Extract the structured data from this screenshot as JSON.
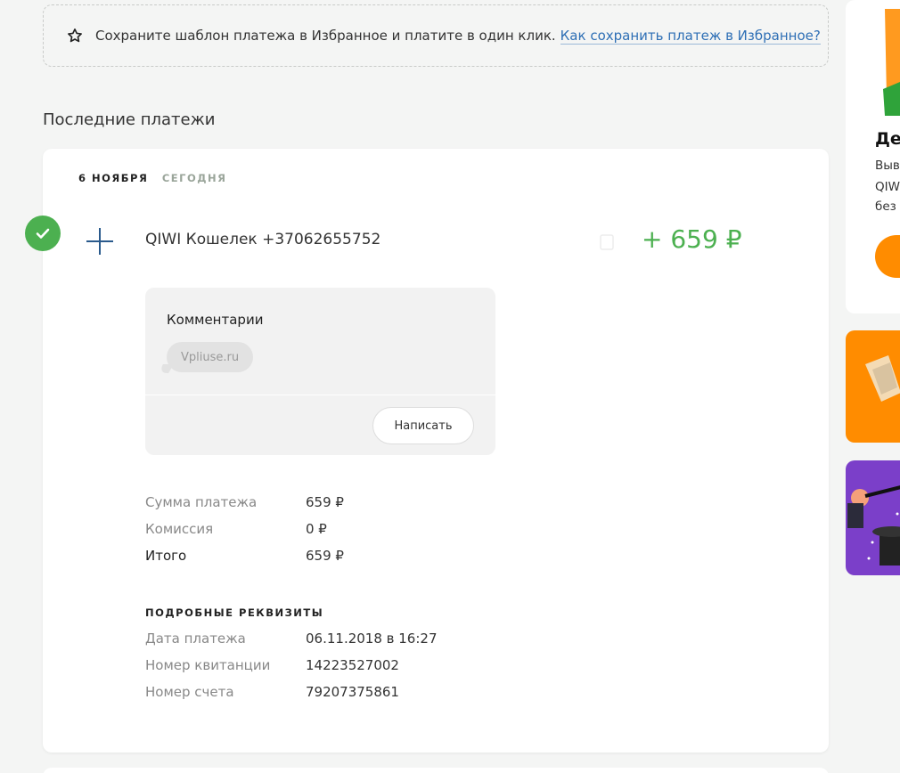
{
  "banner": {
    "text": "Сохраните шаблон платежа в Избранное и платите в один клик.",
    "link": "Как сохранить платеж в Избранное?",
    "icon": "star-outline-icon"
  },
  "section_title": "Последние платежи",
  "payment": {
    "date": "6 ноября",
    "today": "сегодня",
    "status_icon": "check-circle-icon",
    "type_icon": "plus-icon",
    "payee": "QIWI Кошелек +37062655752",
    "amount": "+ 659 ₽",
    "amount_color": "#4cb050"
  },
  "comments": {
    "title": "Комментарии",
    "items": [
      "Vpliuse.ru"
    ],
    "write_button": "Написать"
  },
  "summary": [
    {
      "label": "Сумма платежа",
      "value": "659 ₽"
    },
    {
      "label": "Комиссия",
      "value": "0 ₽"
    },
    {
      "label": "Итого",
      "value": "659 ₽"
    }
  ],
  "details": {
    "title": "ПОДРОБНЫЕ РЕКВИЗИТЫ",
    "rows": [
      {
        "label": "Дата платежа",
        "value": "06.11.2018 в 16:27"
      },
      {
        "label": "Номер квитанции",
        "value": "14223527002"
      },
      {
        "label": "Номер счета",
        "value": "79207375861"
      }
    ]
  },
  "sidebar": {
    "promo_heading": "Де",
    "promo_lines": [
      "Выв",
      "QIW",
      "без"
    ],
    "accent_color": "#ff8c00"
  }
}
